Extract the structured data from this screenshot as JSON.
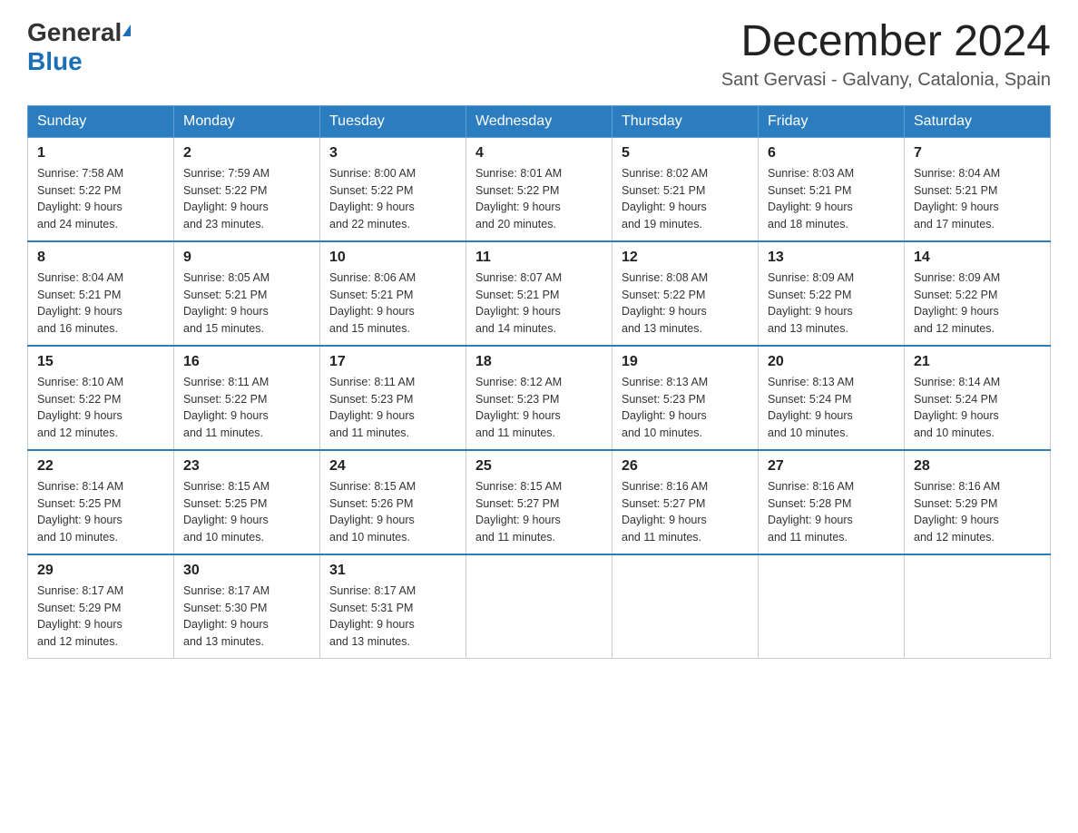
{
  "logo": {
    "general": "General",
    "blue": "Blue"
  },
  "title": "December 2024",
  "subtitle": "Sant Gervasi - Galvany, Catalonia, Spain",
  "days_of_week": [
    "Sunday",
    "Monday",
    "Tuesday",
    "Wednesday",
    "Thursday",
    "Friday",
    "Saturday"
  ],
  "weeks": [
    [
      {
        "day": "1",
        "sunrise": "7:58 AM",
        "sunset": "5:22 PM",
        "daylight": "9 hours and 24 minutes."
      },
      {
        "day": "2",
        "sunrise": "7:59 AM",
        "sunset": "5:22 PM",
        "daylight": "9 hours and 23 minutes."
      },
      {
        "day": "3",
        "sunrise": "8:00 AM",
        "sunset": "5:22 PM",
        "daylight": "9 hours and 22 minutes."
      },
      {
        "day": "4",
        "sunrise": "8:01 AM",
        "sunset": "5:22 PM",
        "daylight": "9 hours and 20 minutes."
      },
      {
        "day": "5",
        "sunrise": "8:02 AM",
        "sunset": "5:21 PM",
        "daylight": "9 hours and 19 minutes."
      },
      {
        "day": "6",
        "sunrise": "8:03 AM",
        "sunset": "5:21 PM",
        "daylight": "9 hours and 18 minutes."
      },
      {
        "day": "7",
        "sunrise": "8:04 AM",
        "sunset": "5:21 PM",
        "daylight": "9 hours and 17 minutes."
      }
    ],
    [
      {
        "day": "8",
        "sunrise": "8:04 AM",
        "sunset": "5:21 PM",
        "daylight": "9 hours and 16 minutes."
      },
      {
        "day": "9",
        "sunrise": "8:05 AM",
        "sunset": "5:21 PM",
        "daylight": "9 hours and 15 minutes."
      },
      {
        "day": "10",
        "sunrise": "8:06 AM",
        "sunset": "5:21 PM",
        "daylight": "9 hours and 15 minutes."
      },
      {
        "day": "11",
        "sunrise": "8:07 AM",
        "sunset": "5:21 PM",
        "daylight": "9 hours and 14 minutes."
      },
      {
        "day": "12",
        "sunrise": "8:08 AM",
        "sunset": "5:22 PM",
        "daylight": "9 hours and 13 minutes."
      },
      {
        "day": "13",
        "sunrise": "8:09 AM",
        "sunset": "5:22 PM",
        "daylight": "9 hours and 13 minutes."
      },
      {
        "day": "14",
        "sunrise": "8:09 AM",
        "sunset": "5:22 PM",
        "daylight": "9 hours and 12 minutes."
      }
    ],
    [
      {
        "day": "15",
        "sunrise": "8:10 AM",
        "sunset": "5:22 PM",
        "daylight": "9 hours and 12 minutes."
      },
      {
        "day": "16",
        "sunrise": "8:11 AM",
        "sunset": "5:22 PM",
        "daylight": "9 hours and 11 minutes."
      },
      {
        "day": "17",
        "sunrise": "8:11 AM",
        "sunset": "5:23 PM",
        "daylight": "9 hours and 11 minutes."
      },
      {
        "day": "18",
        "sunrise": "8:12 AM",
        "sunset": "5:23 PM",
        "daylight": "9 hours and 11 minutes."
      },
      {
        "day": "19",
        "sunrise": "8:13 AM",
        "sunset": "5:23 PM",
        "daylight": "9 hours and 10 minutes."
      },
      {
        "day": "20",
        "sunrise": "8:13 AM",
        "sunset": "5:24 PM",
        "daylight": "9 hours and 10 minutes."
      },
      {
        "day": "21",
        "sunrise": "8:14 AM",
        "sunset": "5:24 PM",
        "daylight": "9 hours and 10 minutes."
      }
    ],
    [
      {
        "day": "22",
        "sunrise": "8:14 AM",
        "sunset": "5:25 PM",
        "daylight": "9 hours and 10 minutes."
      },
      {
        "day": "23",
        "sunrise": "8:15 AM",
        "sunset": "5:25 PM",
        "daylight": "9 hours and 10 minutes."
      },
      {
        "day": "24",
        "sunrise": "8:15 AM",
        "sunset": "5:26 PM",
        "daylight": "9 hours and 10 minutes."
      },
      {
        "day": "25",
        "sunrise": "8:15 AM",
        "sunset": "5:27 PM",
        "daylight": "9 hours and 11 minutes."
      },
      {
        "day": "26",
        "sunrise": "8:16 AM",
        "sunset": "5:27 PM",
        "daylight": "9 hours and 11 minutes."
      },
      {
        "day": "27",
        "sunrise": "8:16 AM",
        "sunset": "5:28 PM",
        "daylight": "9 hours and 11 minutes."
      },
      {
        "day": "28",
        "sunrise": "8:16 AM",
        "sunset": "5:29 PM",
        "daylight": "9 hours and 12 minutes."
      }
    ],
    [
      {
        "day": "29",
        "sunrise": "8:17 AM",
        "sunset": "5:29 PM",
        "daylight": "9 hours and 12 minutes."
      },
      {
        "day": "30",
        "sunrise": "8:17 AM",
        "sunset": "5:30 PM",
        "daylight": "9 hours and 13 minutes."
      },
      {
        "day": "31",
        "sunrise": "8:17 AM",
        "sunset": "5:31 PM",
        "daylight": "9 hours and 13 minutes."
      },
      null,
      null,
      null,
      null
    ]
  ],
  "labels": {
    "sunrise": "Sunrise:",
    "sunset": "Sunset:",
    "daylight": "Daylight:"
  }
}
